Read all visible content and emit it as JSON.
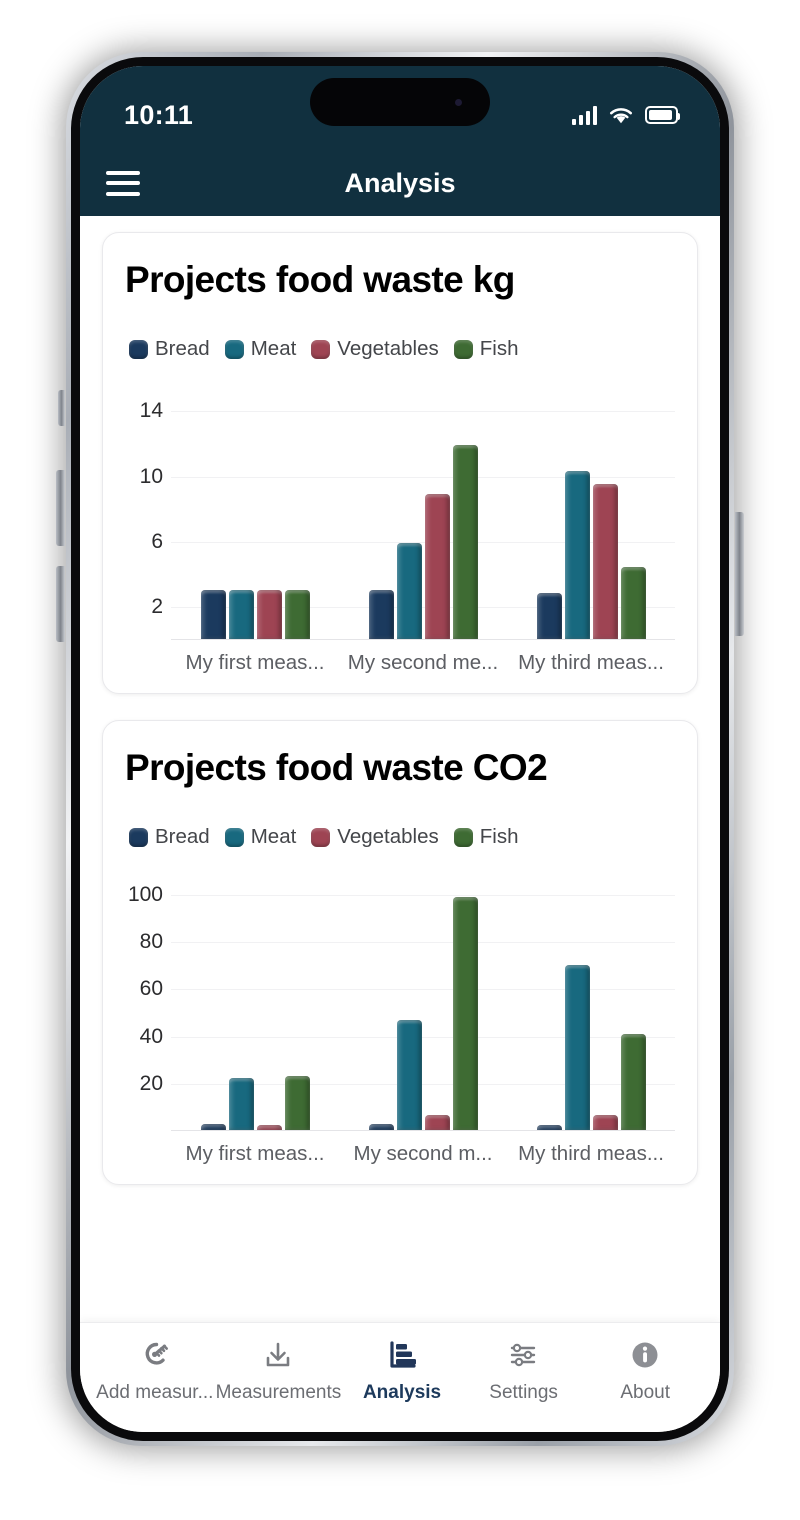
{
  "status_bar": {
    "time": "10:11",
    "signal_icon": "cellular-signal-icon",
    "wifi_icon": "wifi-icon",
    "battery_icon": "battery-icon"
  },
  "app_bar": {
    "menu_icon": "hamburger-menu-icon",
    "title": "Analysis"
  },
  "theme": {
    "header_bg": "#11303f",
    "accent": "#1d3a5c",
    "card_bg": "#ffffff",
    "muted_text": "#6c6e73"
  },
  "series_colors": {
    "bread": "#1b3a5e",
    "meat": "#18697f",
    "vegetables": "#9e4453",
    "fish": "#3e6b33"
  },
  "legend": [
    {
      "label": "Bread",
      "color": "#1b3a5e"
    },
    {
      "label": "Meat",
      "color": "#18697f"
    },
    {
      "label": "Vegetables",
      "color": "#9e4453"
    },
    {
      "label": "Fish",
      "color": "#3e6b33"
    }
  ],
  "cards": [
    {
      "title": "Projects food waste kg"
    },
    {
      "title": "Projects food waste CO2"
    }
  ],
  "chart_data": [
    {
      "type": "bar",
      "title": "Projects food waste kg",
      "xlabel": "",
      "ylabel": "",
      "ylim": [
        0,
        15
      ],
      "yticks": [
        2,
        6,
        10,
        14
      ],
      "grid": true,
      "legend_position": "top-left",
      "categories": [
        "My first meas...",
        "My second me...",
        "My third meas..."
      ],
      "series": [
        {
          "name": "Bread",
          "color": "#1b3a5e",
          "values": [
            3,
            3,
            2.8
          ]
        },
        {
          "name": "Meat",
          "color": "#18697f",
          "values": [
            3,
            5.9,
            10.3
          ]
        },
        {
          "name": "Vegetables",
          "color": "#9e4453",
          "values": [
            3,
            8.9,
            9.5
          ]
        },
        {
          "name": "Fish",
          "color": "#3e6b33",
          "values": [
            3,
            11.9,
            4.4
          ]
        }
      ]
    },
    {
      "type": "bar",
      "title": "Projects food waste CO2",
      "xlabel": "",
      "ylabel": "",
      "ylim": [
        0,
        105
      ],
      "yticks": [
        20,
        40,
        60,
        80,
        100
      ],
      "grid": true,
      "legend_position": "top-left",
      "categories": [
        "My first meas...",
        "My second m...",
        "My third meas..."
      ],
      "series": [
        {
          "name": "Bread",
          "color": "#1b3a5e",
          "values": [
            2.5,
            2.5,
            2
          ]
        },
        {
          "name": "Meat",
          "color": "#18697f",
          "values": [
            22,
            46.5,
            70
          ]
        },
        {
          "name": "Vegetables",
          "color": "#9e4453",
          "values": [
            2,
            6.5,
            6.5
          ]
        },
        {
          "name": "Fish",
          "color": "#3e6b33",
          "values": [
            23,
            98.5,
            40.5
          ]
        }
      ]
    }
  ],
  "bottom_nav": [
    {
      "label": "Add measur...",
      "icon": "scale-icon",
      "active": false
    },
    {
      "label": "Measurements",
      "icon": "download-icon",
      "active": false
    },
    {
      "label": "Analysis",
      "icon": "bar-chart-icon",
      "active": true
    },
    {
      "label": "Settings",
      "icon": "sliders-icon",
      "active": false
    },
    {
      "label": "About",
      "icon": "info-circle-icon",
      "active": false
    }
  ]
}
